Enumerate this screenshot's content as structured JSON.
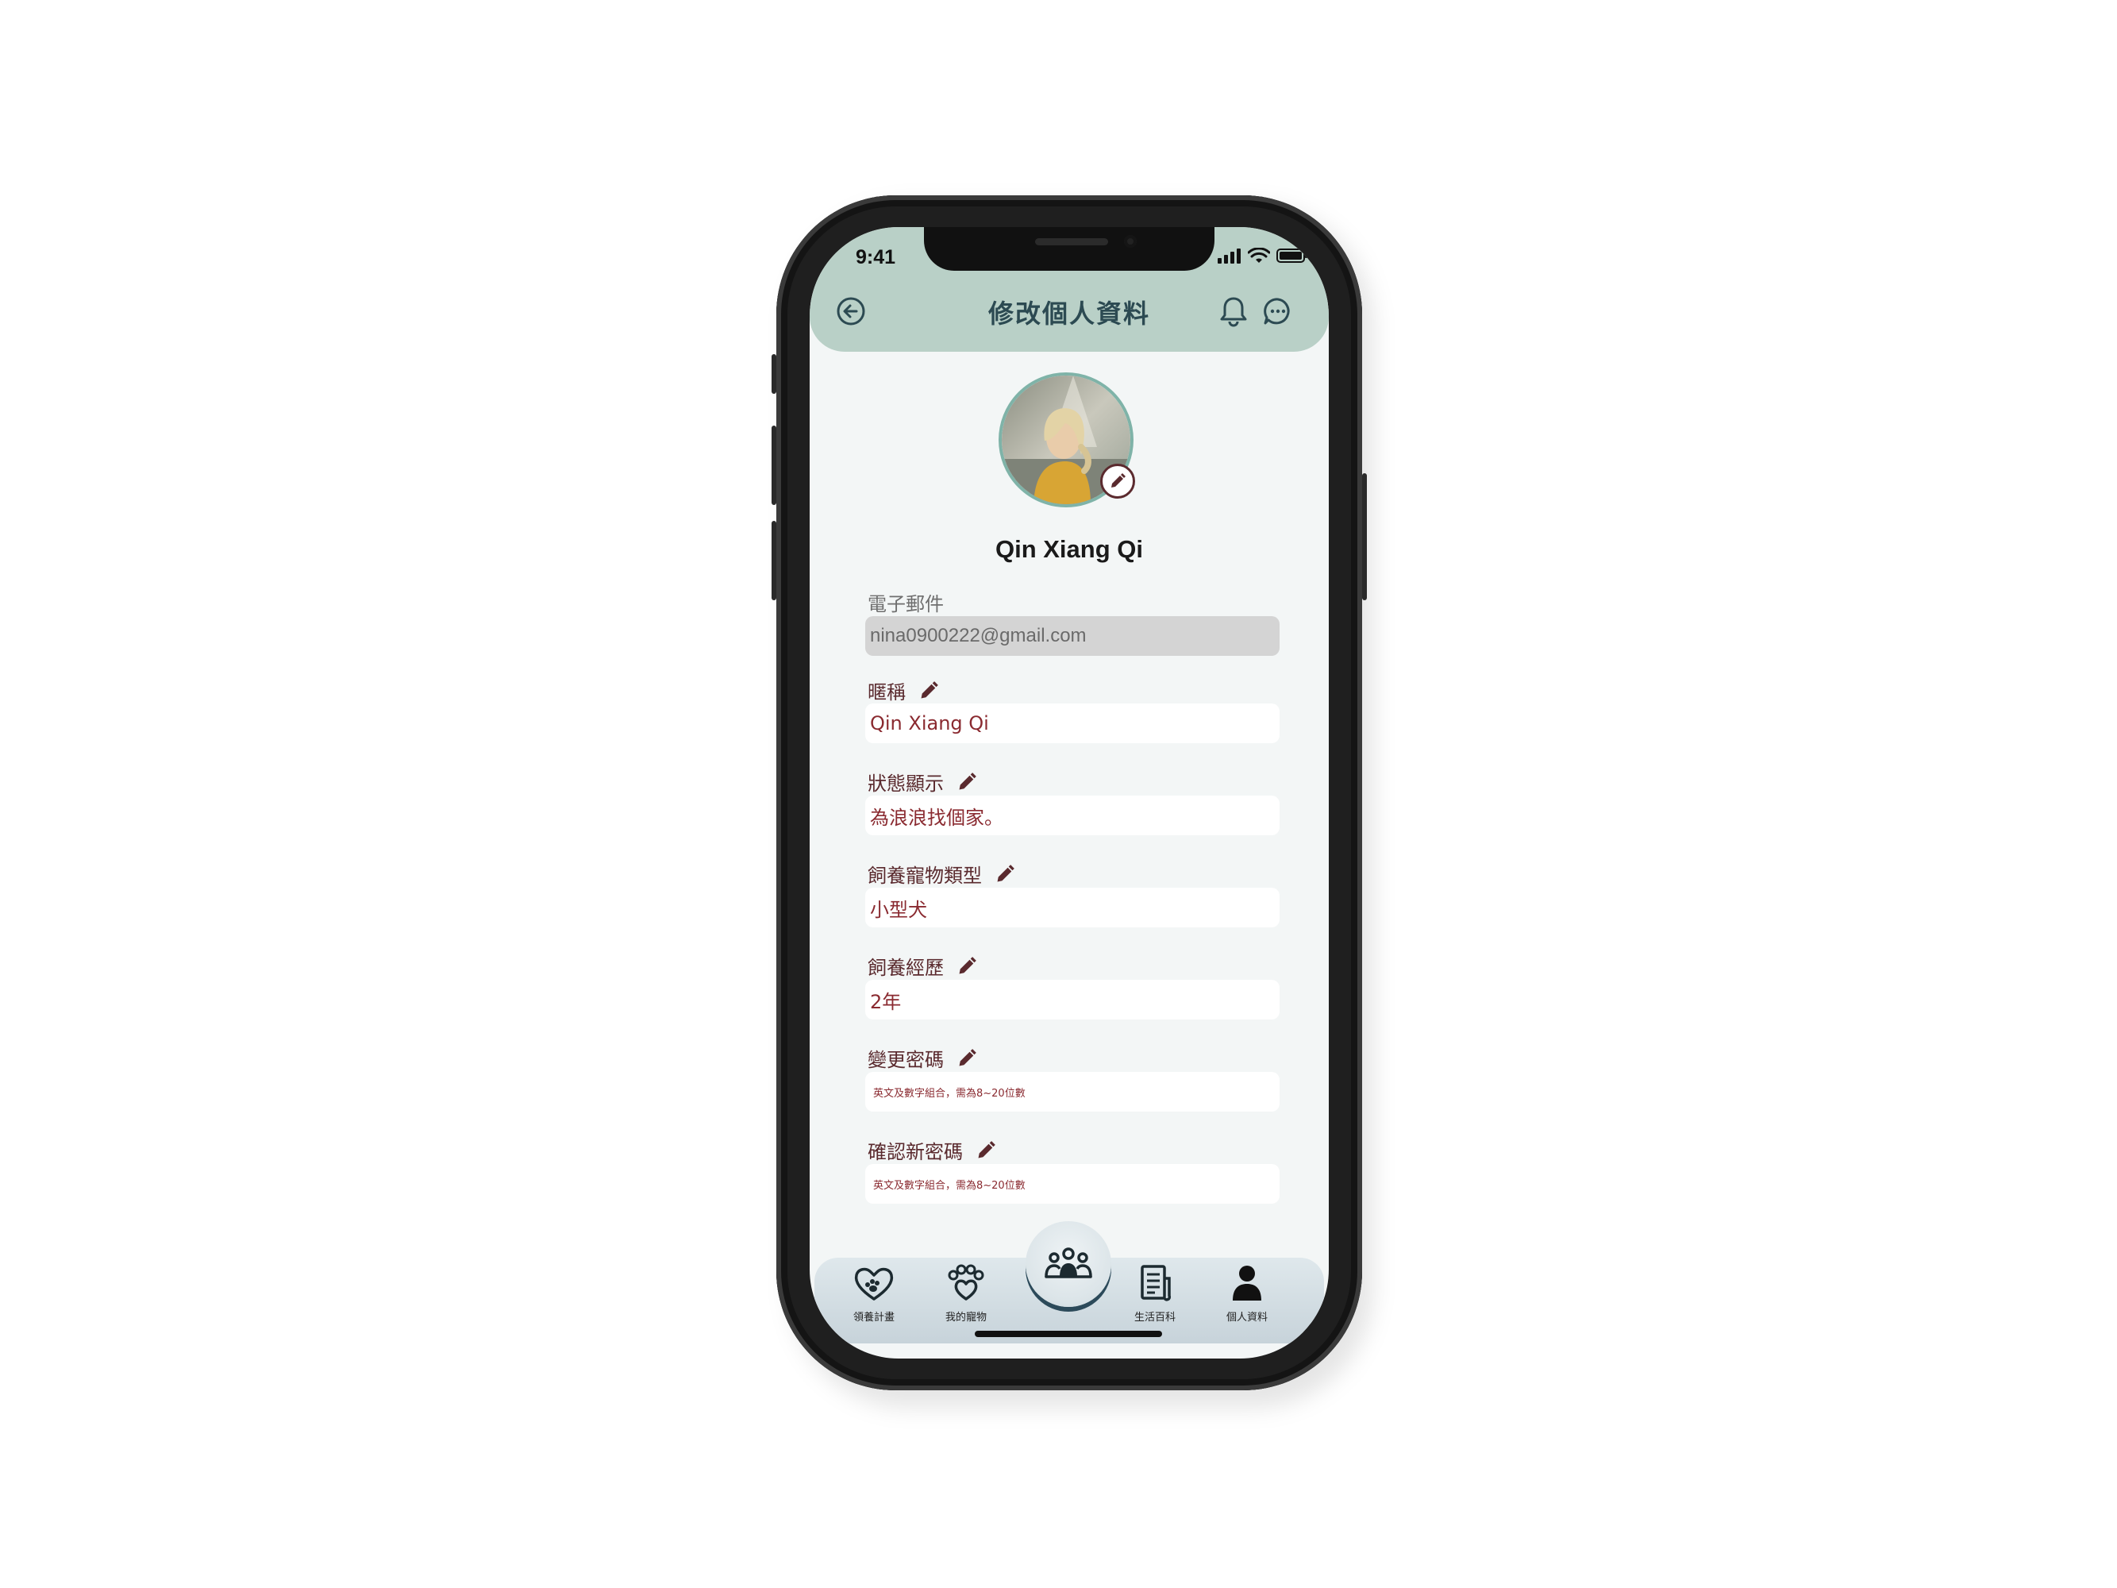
{
  "status_bar": {
    "time": "9:41"
  },
  "header": {
    "title": "修改個人資料"
  },
  "profile": {
    "name": "Qin Xiang Qi"
  },
  "form": {
    "email": {
      "label": "電子郵件",
      "value": "nina0900222@gmail.com"
    },
    "nickname": {
      "label": "暱稱",
      "value": "Qin Xiang Qi"
    },
    "status": {
      "label": "狀態顯示",
      "value": "為浪浪找個家。"
    },
    "pet_type": {
      "label": "飼養寵物類型",
      "value": "小型犬"
    },
    "experience": {
      "label": "飼養經歷",
      "value": "2年"
    },
    "change_password": {
      "label": "變更密碼",
      "placeholder": "英文及數字組合，需為8~20位數"
    },
    "confirm_password": {
      "label": "確認新密碼",
      "placeholder": "英文及數字組合，需為8~20位數"
    }
  },
  "nav": {
    "items": [
      {
        "label": "領養計畫",
        "icon": "heart-paw-icon"
      },
      {
        "label": "我的寵物",
        "icon": "paw-heart-icon"
      },
      {
        "label": "",
        "icon": "community-icon"
      },
      {
        "label": "生活百科",
        "icon": "article-icon"
      },
      {
        "label": "個人資料",
        "icon": "person-icon"
      }
    ]
  },
  "colors": {
    "header_bg": "#b9d0c7",
    "title": "#2c4a52",
    "accent": "#5a2a2e",
    "value_text": "#8a2a30",
    "screen_bg": "#f3f6f6"
  }
}
